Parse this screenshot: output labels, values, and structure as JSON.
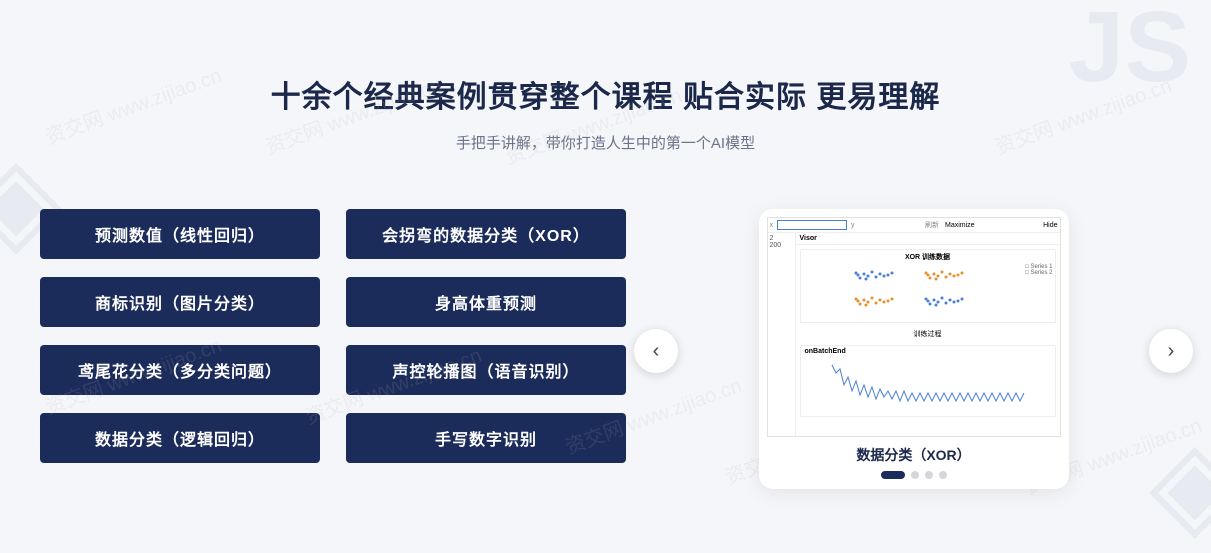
{
  "header": {
    "title": "十余个经典案例贯穿整个课程 贴合实际 更易理解",
    "subtitle": "手把手讲解，带你打造人生中的第一个AI模型"
  },
  "tags": [
    "预测数值（线性回归）",
    "会拐弯的数据分类（XOR）",
    "商标识别（图片分类）",
    "身高体重预测",
    "鸢尾花分类（多分类问题）",
    "声控轮播图（语音识别）",
    "数据分类（逻辑回归）",
    "手写数字识别"
  ],
  "carousel": {
    "card_label": "数据分类（XOR）",
    "active_index": 0,
    "total_dots": 4,
    "visor": {
      "title": "Visor",
      "maximize": "Maximize",
      "hide": "Hide",
      "left_vals": [
        "2",
        "200"
      ],
      "scatter_title": "XOR 训练数据",
      "legend": [
        "Series 1",
        "Series 2"
      ],
      "line_section": "训练过程",
      "line_title": "onBatchEnd"
    }
  },
  "watermark": "资交网 www.zijiao.cn"
}
